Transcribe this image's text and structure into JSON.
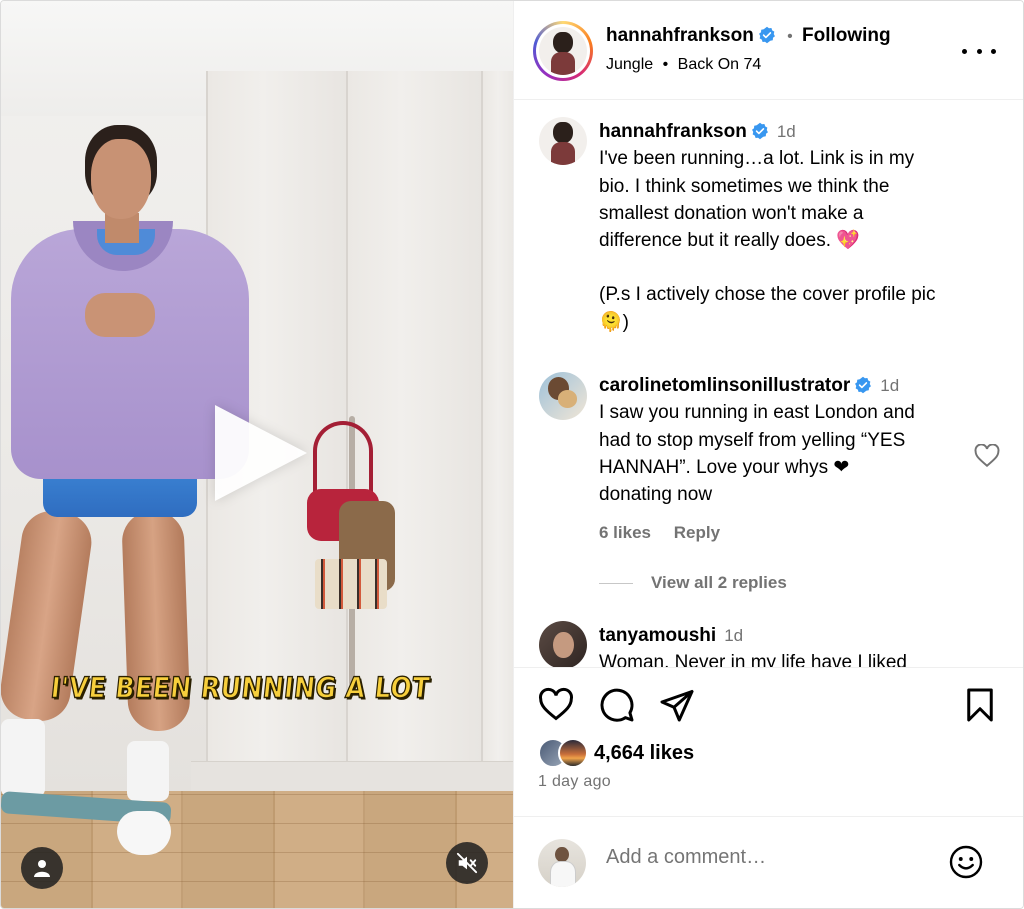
{
  "video": {
    "caption": "I'VE BEEN RUNNING A LOT"
  },
  "header": {
    "username": "hannahfrankson",
    "separator": "•",
    "follow_status": "Following",
    "audio_artist": "Jungle",
    "audio_separator": "•",
    "audio_track": "Back On 74"
  },
  "post": {
    "username": "hannahfrankson",
    "time": "1d",
    "caption_lines": [
      "I've been running…a lot. Link is in my",
      "bio. I think sometimes we think the",
      "smallest donation won't make a",
      "difference but it really does. 💖"
    ],
    "ps_line_1": "(P.s I actively chose the cover profile pic",
    "ps_line_2": "🫠)"
  },
  "comments": [
    {
      "username": "carolinetomlinsonillustrator",
      "time": "1d",
      "lines": [
        "I saw you running in east London and",
        "had to stop myself from yelling “YES",
        "HANNAH”. Love your whys ❤",
        "donating now"
      ],
      "likes": "6 likes",
      "reply_label": "Reply",
      "view_replies": "View all 2 replies"
    },
    {
      "username": "tanyamoushi",
      "time": "1d",
      "lines": [
        "Woman. Never in my life have I liked"
      ]
    }
  ],
  "likes": {
    "count_text": "4,664 likes"
  },
  "time_ago": "1 day ago",
  "comment_box": {
    "placeholder": "Add a comment…"
  },
  "colors": {
    "verified_blue": "#3897f0",
    "muted_text": "#737373",
    "caption_yellow": "#f7cf3c"
  },
  "icons": [
    "play-icon",
    "person-tag-icon",
    "mute-icon",
    "more-icon",
    "verified-icon",
    "heart-icon",
    "comment-icon",
    "share-icon",
    "bookmark-icon",
    "emoji-icon"
  ]
}
